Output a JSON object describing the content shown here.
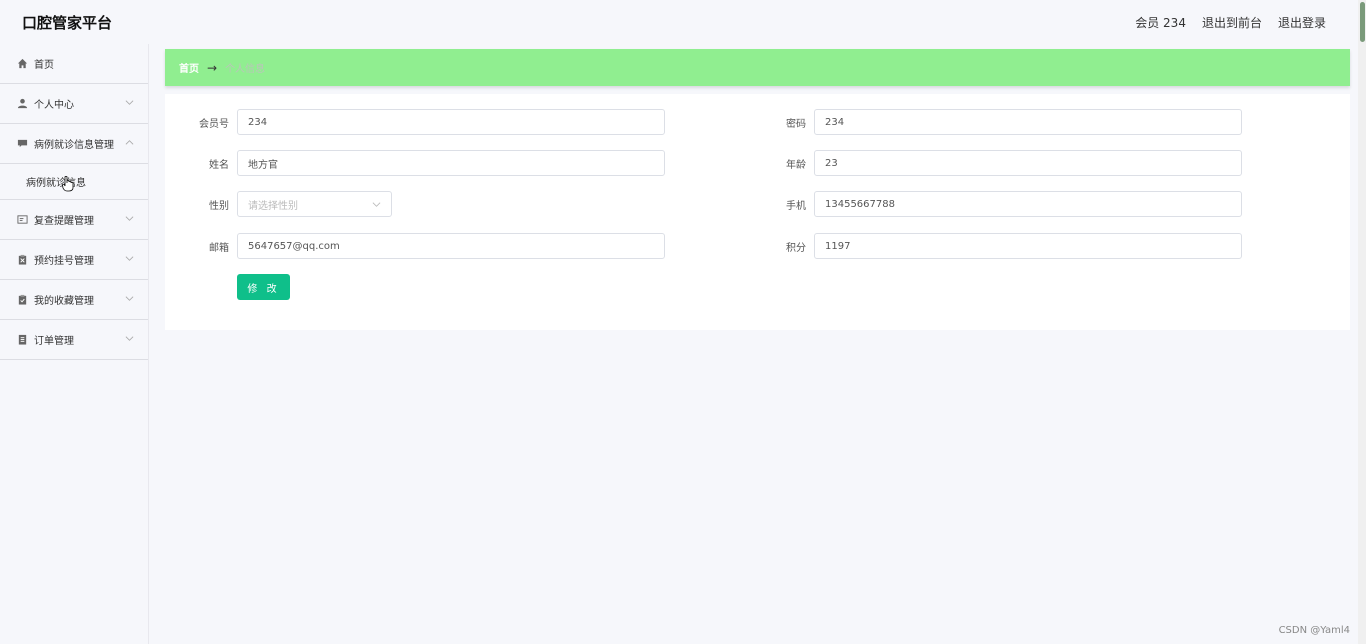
{
  "app": {
    "title": "口腔管家平台"
  },
  "header": {
    "user_label": "会员 234",
    "to_frontend": "退出到前台",
    "logout": "退出登录"
  },
  "sidebar": {
    "items": [
      {
        "label": "首页",
        "icon": "home-icon"
      },
      {
        "label": "个人中心",
        "icon": "user-icon"
      },
      {
        "label": "病例就诊信息管理",
        "icon": "chat-icon",
        "expanded": true
      },
      {
        "label": "复查提醒管理",
        "icon": "card-icon"
      },
      {
        "label": "预约挂号管理",
        "icon": "clipboard-icon"
      },
      {
        "label": "我的收藏管理",
        "icon": "clipboard-icon"
      },
      {
        "label": "订单管理",
        "icon": "doc-icon"
      }
    ],
    "submenu": [
      {
        "label": "病例就诊信息"
      }
    ]
  },
  "breadcrumb": {
    "home": "首页",
    "arrow": "→",
    "current": "个人信息"
  },
  "form": {
    "member_no": {
      "label": "会员号",
      "value": "234"
    },
    "password": {
      "label": "密码",
      "value": "234"
    },
    "name": {
      "label": "姓名",
      "value": "地方官"
    },
    "age": {
      "label": "年龄",
      "value": "23"
    },
    "gender": {
      "label": "性别",
      "placeholder": "请选择性别"
    },
    "phone": {
      "label": "手机",
      "value": "13455667788"
    },
    "email": {
      "label": "邮箱",
      "value": "5647657@qq.com"
    },
    "points": {
      "label": "积分",
      "value": "1197"
    },
    "submit_label": "修 改"
  },
  "watermark": "CSDN @Yaml4",
  "colors": {
    "breadcrumb_bg": "#90ee90",
    "button_bg": "#0fbf8a",
    "page_bg": "#f6f7fb"
  }
}
